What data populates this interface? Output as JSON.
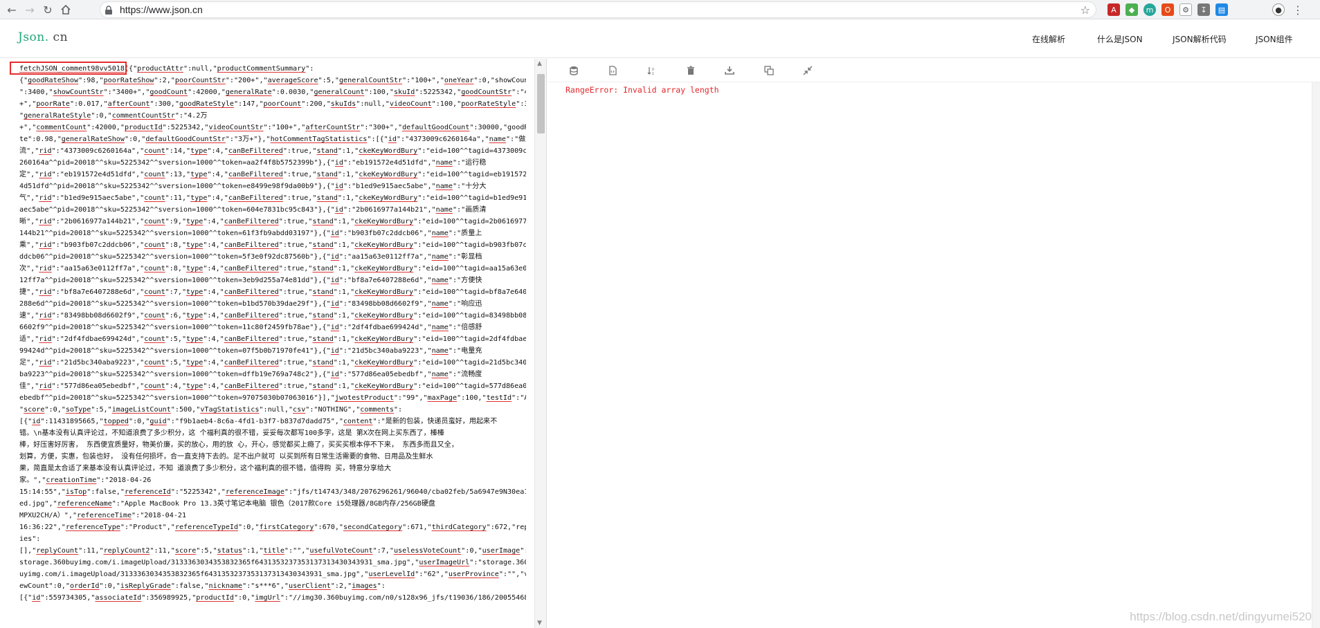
{
  "browser": {
    "url": "https://www.json.cn"
  },
  "site": {
    "logo_main": "Json.",
    "logo_suffix": "cn",
    "nav": [
      {
        "label": "在线解析"
      },
      {
        "label": "什么是JSON"
      },
      {
        "label": "JSON解析代码"
      },
      {
        "label": "JSON组件"
      }
    ]
  },
  "editor": {
    "lines": [
      "fetchJSON_comment98vv5018({\"productAttr\":null,\"productCommentSummary\":",
      "{\"goodRateShow\":98,\"poorRateShow\":2,\"poorCountStr\":\"200+\",\"averageScore\":5,\"generalCountStr\":\"100+\",\"oneYear\":0,\"showCount",
      "\":3400,\"showCountStr\":\"3400+\",\"goodCount\":42000,\"generalRate\":0.0030,\"generalCount\":100,\"skuId\":5225342,\"goodCountStr\":\"4.2万",
      "+\",\"poorRate\":0.017,\"afterCount\":300,\"goodRateStyle\":147,\"poorCount\":200,\"skuIds\":null,\"videoCount\":100,\"poorRateStyle\":3,",
      "\"generalRateStyle\":0,\"commentCountStr\":\"4.2万",
      "+\",\"commentCount\":42000,\"productId\":5225342,\"videoCountStr\":\"100+\",\"afterCountStr\":\"300+\",\"defaultGoodCount\":30000,\"goodRa",
      "te\":0.98,\"generalRateShow\":0,\"defaultGoodCountStr\":\"3万+\"},\"hotCommentTagStatistics\":[{\"id\":\"4373009c6260164a\",\"name\":\"做工一",
      "流\",\"rid\":\"4373009c6260164a\",\"count\":14,\"type\":4,\"canBeFiltered\":true,\"stand\":1,\"ckeKeyWordBury\":\"eid=100^^tagid=4373009c6",
      "260164a^^pid=20018^^sku=5225342^^sversion=1000^^token=aa2f4f8b5752399b\"},{\"id\":\"eb191572e4d51dfd\",\"name\":\"运行稳",
      "定\",\"rid\":\"eb191572e4d51dfd\",\"count\":13,\"type\":4,\"canBeFiltered\":true,\"stand\":1,\"ckeKeyWordBury\":\"eid=100^^tagid=eb191572e",
      "4d51dfd^^pid=20018^^sku=5225342^^sversion=1000^^token=e8499e98f9da00b9\"},{\"id\":\"b1ed9e915aec5abe\",\"name\":\"十分大",
      "气\",\"rid\":\"b1ed9e915aec5abe\",\"count\":11,\"type\":4,\"canBeFiltered\":true,\"stand\":1,\"ckeKeyWordBury\":\"eid=100^^tagid=b1ed9e915",
      "aec5abe^^pid=20018^^sku=5225342^^sversion=1000^^token=604e7831bc95c843\"},{\"id\":\"2b0616977a144b21\",\"name\":\"画质清",
      "晰\",\"rid\":\"2b0616977a144b21\",\"count\":9,\"type\":4,\"canBeFiltered\":true,\"stand\":1,\"ckeKeyWordBury\":\"eid=100^^tagid=2b0616977a",
      "144b21^^pid=20018^^sku=5225342^^sversion=1000^^token=61f3fb9abdd03197\"},{\"id\":\"b903fb07c2ddcb06\",\"name\":\"质量上",
      "乘\",\"rid\":\"b903fb07c2ddcb06\",\"count\":8,\"type\":4,\"canBeFiltered\":true,\"stand\":1,\"ckeKeyWordBury\":\"eid=100^^tagid=b903fb07c2",
      "ddcb06^^pid=20018^^sku=5225342^^sversion=1000^^token=5f3e0f92dc87560b\"},{\"id\":\"aa15a63e0112ff7a\",\"name\":\"彰显档",
      "次\",\"rid\":\"aa15a63e0112ff7a\",\"count\":8,\"type\":4,\"canBeFiltered\":true,\"stand\":1,\"ckeKeyWordBury\":\"eid=100^^tagid=aa15a63e01",
      "12ff7a^^pid=20018^^sku=5225342^^sversion=1000^^token=3eb9d255a74e81dd\"},{\"id\":\"bf8a7e6407288e6d\",\"name\":\"方便快",
      "捷\",\"rid\":\"bf8a7e6407288e6d\",\"count\":7,\"type\":4,\"canBeFiltered\":true,\"stand\":1,\"ckeKeyWordBury\":\"eid=100^^tagid=bf8a7e6407",
      "288e6d^^pid=20018^^sku=5225342^^sversion=1000^^token=b1bd570b39dae29f\"},{\"id\":\"83498bb08d6602f9\",\"name\":\"响应迅",
      "速\",\"rid\":\"83498bb08d6602f9\",\"count\":6,\"type\":4,\"canBeFiltered\":true,\"stand\":1,\"ckeKeyWordBury\":\"eid=100^^tagid=83498bb08d",
      "6602f9^^pid=20018^^sku=5225342^^sversion=1000^^token=11c80f2459fb78ae\"},{\"id\":\"2df4fdbae699424d\",\"name\":\"倍感舒",
      "适\",\"rid\":\"2df4fdbae699424d\",\"count\":5,\"type\":4,\"canBeFiltered\":true,\"stand\":1,\"ckeKeyWordBury\":\"eid=100^^tagid=2df4fdbae6",
      "99424d^^pid=20018^^sku=5225342^^sversion=1000^^token=07f5b0b71970fe41\"},{\"id\":\"21d5bc340aba9223\",\"name\":\"电量充",
      "足\",\"rid\":\"21d5bc340aba9223\",\"count\":5,\"type\":4,\"canBeFiltered\":true,\"stand\":1,\"ckeKeyWordBury\":\"eid=100^^tagid=21d5bc340a",
      "ba9223^^pid=20018^^sku=5225342^^sversion=1000^^token=dffb19e769a748c2\"},{\"id\":\"577d86ea05ebedbf\",\"name\":\"流畅度",
      "佳\",\"rid\":\"577d86ea05ebedbf\",\"count\":4,\"type\":4,\"canBeFiltered\":true,\"stand\":1,\"ckeKeyWordBury\":\"eid=100^^tagid=577d86ea05",
      "ebedbf^^pid=20018^^sku=5225342^^sversion=1000^^token=97075030b07063016\"}],\"jwotestProduct\":\"99\",\"maxPage\":100,\"testId\":\"A\",",
      "\"score\":0,\"soType\":5,\"imageListCount\":500,\"vTagStatistics\":null,\"csv\":\"NOTHING\",\"comments\":",
      "[{\"id\":11431895665,\"topped\":0,\"guid\":\"f9b1aeb4-8c6a-4fd1-b3f7-b837d7dadd75\",\"content\":\"是新的包装，快递员蛮好，用起来不",
      "错。\\n基本没有认真评论过，不知道浪费了多少积分，这 个福利真的很不错，妥妥每次都写100多字，这是 第X次在网上买东西了，榛榛",
      "棒，好压害好厉害， 东西便宜质量好，物美价廉，买的放心，用的放 心，开心，感觉都买上瘾了，买买买根本停不下来， 东西多而且又全，",
      "划算，方便，实惠，包装也好， 没有任何损坏，合一直支持下去的。足不出户就可 以买到所有日常生活需要的食物、日用品及生鲜水",
      "果，简直是太合适了来基本没有认真评论过，不知 道浪费了多少积分，这个福利真的很不错，值得购 买，特意分享给大",
      "家。\",\"creationTime\":\"2018-04-26",
      "15:14:55\",\"isTop\":false,\"referenceId\":\"5225342\",\"referenceImage\":\"jfs/t14743/348/2076296261/96040/cba02feb/5a6947e9N30ea15",
      "ed.jpg\",\"referenceName\":\"Apple MacBook Pro 13.3英寸笔记本电脑 银色（2017款Core i5处理器/8GB内存/256GB硬盘",
      "MPXU2CH/A）\",\"referenceTime\":\"2018-04-21",
      "16:36:22\",\"referenceType\":\"Product\",\"referenceTypeId\":0,\"firstCategory\":670,\"secondCategory\":671,\"thirdCategory\":672,\"repl",
      "ies\":",
      "[],\"replyCount\":11,\"replyCount2\":11,\"score\":5,\"status\":1,\"title\":\"\",\"usefulVoteCount\":7,\"uselessVoteCount\":0,\"userImage\":\"",
      "storage.360buyimg.com/i.imageUpload/3133363034353832365f6431353237353137313430343931_sma.jpg\",\"userImageUrl\":\"storage.360b",
      "uyimg.com/i.imageUpload/3133363034353832365f6431353237353137313430343931_sma.jpg\",\"userLevelId\":\"62\",\"userProvince\":\"\",\"vi",
      "ewCount\":0,\"orderId\":0,\"isReplyGrade\":false,\"nickname\":\"s***6\",\"userClient\":2,\"images\":",
      "[{\"id\":559734305,\"associateId\":356989925,\"productId\":0,\"imgUrl\":\"//img30.360buyimg.com/n0/s128x96_jfs/t19036/186/200554681"
    ]
  },
  "result": {
    "error": "RangeError: Invalid array length"
  },
  "watermark": "https://blog.csdn.net/dingyumei520"
}
